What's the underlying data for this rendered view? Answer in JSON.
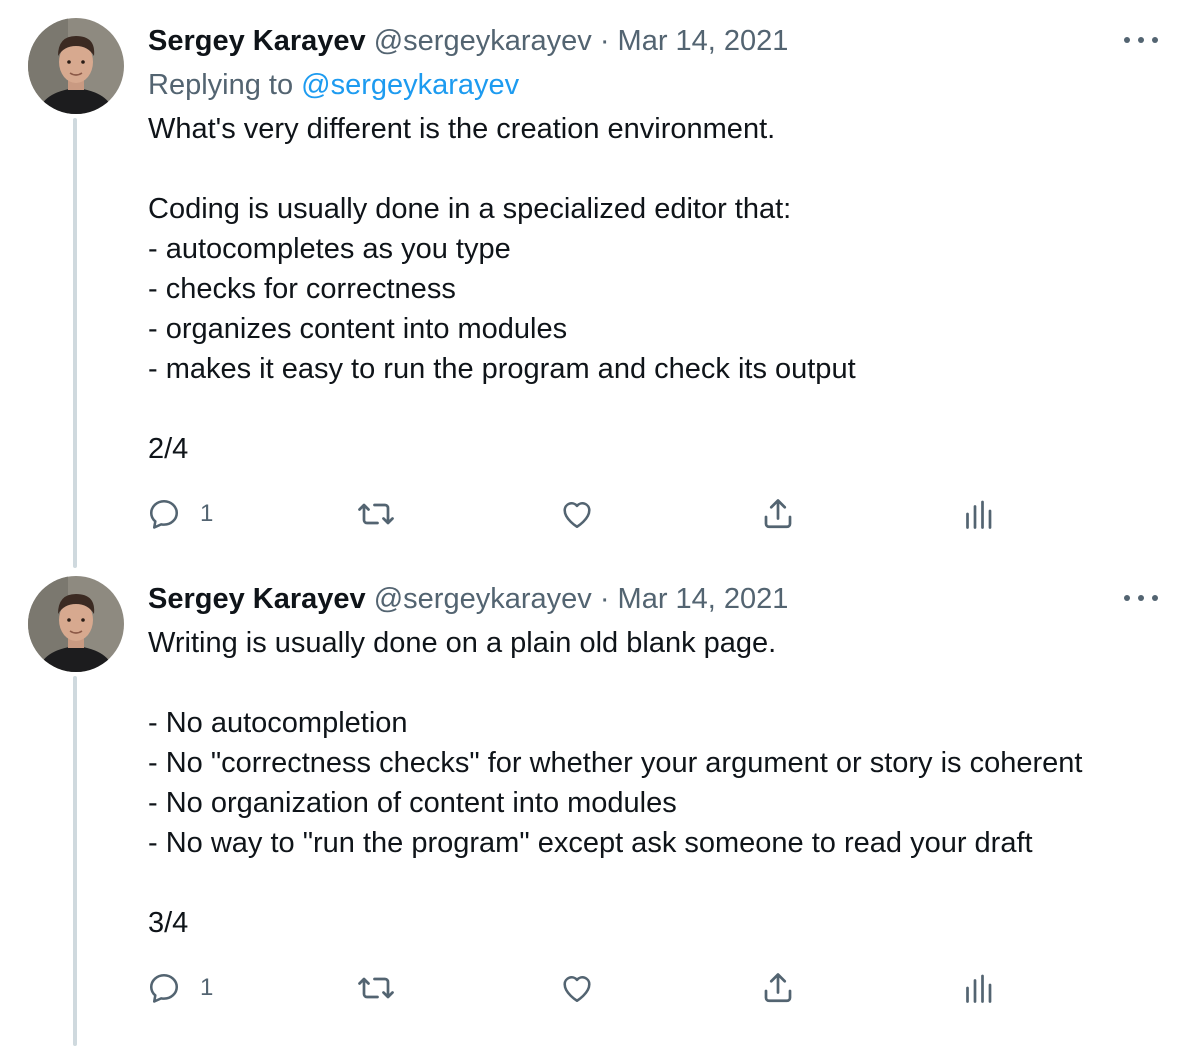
{
  "tweets": [
    {
      "author": {
        "display_name": "Sergey Karayev",
        "handle": "@sergeykarayev",
        "avatar_icon": "profile-photo"
      },
      "separator": "·",
      "date": "Mar 14, 2021",
      "replying_prefix": "Replying to",
      "replying_to": "@sergeykarayev",
      "lines": [
        "What's very different is the creation environment.",
        "",
        "Coding is usually done in a specialized editor that:",
        "- autocompletes as you type",
        "- checks for correctness",
        "- organizes content into modules",
        "- makes it easy to run the program and check its output",
        "",
        "2/4"
      ],
      "actions": {
        "reply_count": "1",
        "icons": [
          "reply-icon",
          "retweet-icon",
          "like-icon",
          "share-icon",
          "analytics-icon"
        ]
      }
    },
    {
      "author": {
        "display_name": "Sergey Karayev",
        "handle": "@sergeykarayev",
        "avatar_icon": "profile-photo"
      },
      "separator": "·",
      "date": "Mar 14, 2021",
      "lines": [
        "Writing is usually done on a plain old blank page.",
        "",
        "- No autocompletion",
        "- No \"correctness checks\" for whether your argument or story is coherent",
        "- No organization of content into modules",
        "- No way to \"run the program\" except ask someone to read your draft",
        "",
        "3/4"
      ],
      "actions": {
        "reply_count": "1",
        "icons": [
          "reply-icon",
          "retweet-icon",
          "like-icon",
          "share-icon",
          "analytics-icon"
        ]
      }
    }
  ],
  "colors": {
    "text": "#0f1419",
    "secondary": "#536471",
    "link": "#1d9bf0",
    "thread_line": "#cfd9de"
  }
}
